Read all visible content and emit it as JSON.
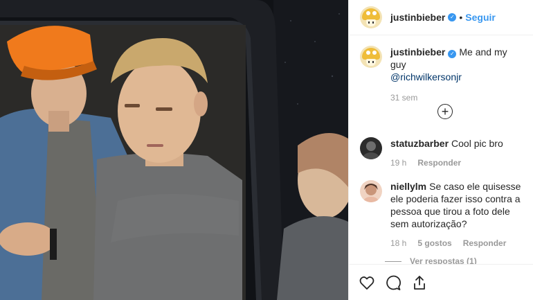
{
  "post": {
    "username": "justinbieber",
    "verified_mark": "✓",
    "separator": "•",
    "follow_label": "Seguir",
    "caption_text": "Me and my guy",
    "caption_mention": "@richwilkersonjr",
    "time_ago": "31 sem",
    "load_more_symbol": "+"
  },
  "comments": [
    {
      "username": "statuzbarber",
      "text": "Cool pic bro",
      "time": "19 h",
      "likes": "",
      "reply_label": "Responder",
      "avatar_icon": "user-avatar-icon"
    },
    {
      "username": "niellylm",
      "text": "Se caso ele quisesse ele poderia fazer isso contra a pessoa que tirou a foto dele sem autorização?",
      "time": "18 h",
      "likes": "5 gostos",
      "reply_label": "Responder",
      "view_replies": "Ver respostas (1)",
      "avatar_icon": "user-avatar-icon"
    }
  ],
  "actions": {
    "like_icon": "heart-icon",
    "comment_icon": "comment-bubble-icon",
    "share_icon": "share-icon"
  },
  "colors": {
    "link": "#3897f0",
    "mention": "#003569",
    "muted": "#999999"
  }
}
